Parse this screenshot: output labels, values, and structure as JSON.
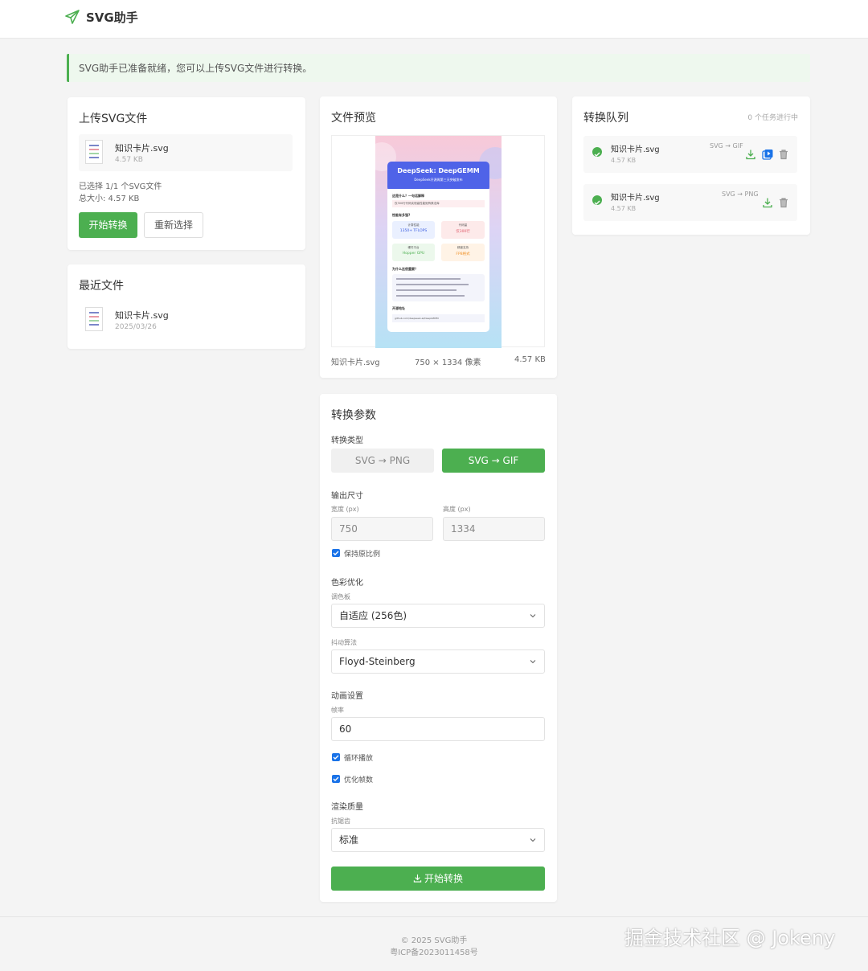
{
  "header": {
    "app_name": "SVG助手"
  },
  "notice": {
    "text": "SVG助手已准备就绪，您可以上传SVG文件进行转换。"
  },
  "upload": {
    "title": "上传SVG文件",
    "file": {
      "name": "知识卡片.svg",
      "size": "4.57 KB"
    },
    "selected_text": "已选择 1/1 个SVG文件",
    "total_text": "总大小: 4.57 KB",
    "start_label": "开始转换",
    "reselect_label": "重新选择"
  },
  "recent": {
    "title": "最近文件",
    "file": {
      "name": "知识卡片.svg",
      "date": "2025/03/26"
    }
  },
  "preview": {
    "title": "文件预览",
    "file_name": "知识卡片.svg",
    "dimensions": "750 × 1334 像素",
    "size": "4.57 KB",
    "svg_card": {
      "title": "DeepSeek: DeepGEMM",
      "subtitle": "DeepSeek开源周第三天突破发布",
      "q1": "这是什么？一句话解释",
      "a1": "仅300行代码实现高性能矩阵乘法库",
      "q2": "性能有多强?",
      "stats": [
        {
          "label": "计算性能",
          "value": "1350+ TFLOPS"
        },
        {
          "label": "代码量",
          "value": "仅300行"
        },
        {
          "label": "硬件平台",
          "value": "Hopper GPU"
        },
        {
          "label": "精度支持",
          "value": "FP8格式"
        }
      ],
      "q3": "为什么这很重要？",
      "q4": "开源地址",
      "link": "github.com/deepseek-ai/DeepGEMM"
    }
  },
  "params": {
    "title": "转换参数",
    "type_label": "转换类型",
    "type_png": "SVG → PNG",
    "type_gif": "SVG → GIF",
    "size_label": "输出尺寸",
    "width_label": "宽度 (px)",
    "height_label": "高度 (px)",
    "width_value": "750",
    "height_value": "1334",
    "keep_ratio": "保持原比例",
    "color_label": "色彩优化",
    "palette_label": "调色板",
    "palette_value": "自适应 (256色)",
    "dither_label": "抖动算法",
    "dither_value": "Floyd-Steinberg",
    "anim_label": "动画设置",
    "fps_label": "帧率",
    "fps_value": "60",
    "loop_label": "循环播放",
    "optimize_label": "优化帧数",
    "render_label": "渲染质量",
    "aa_label": "抗锯齿",
    "aa_value": "标准",
    "submit_label": "开始转换"
  },
  "queue": {
    "title": "转换队列",
    "status": "0 个任务进行中",
    "tasks": [
      {
        "name": "知识卡片.svg",
        "size": "4.57 KB",
        "type": "SVG → GIF"
      },
      {
        "name": "知识卡片.svg",
        "size": "4.57 KB",
        "type": "SVG → PNG"
      }
    ]
  },
  "footer": {
    "copyright": "© 2025 SVG助手",
    "icp": "粤ICP备2023011458号",
    "watermark": "掘金技术社区 @ Jokeny"
  },
  "colors": {
    "accent": "#4caf50",
    "checkbox": "#1a73e8",
    "notice_bg": "#eef8ee"
  }
}
